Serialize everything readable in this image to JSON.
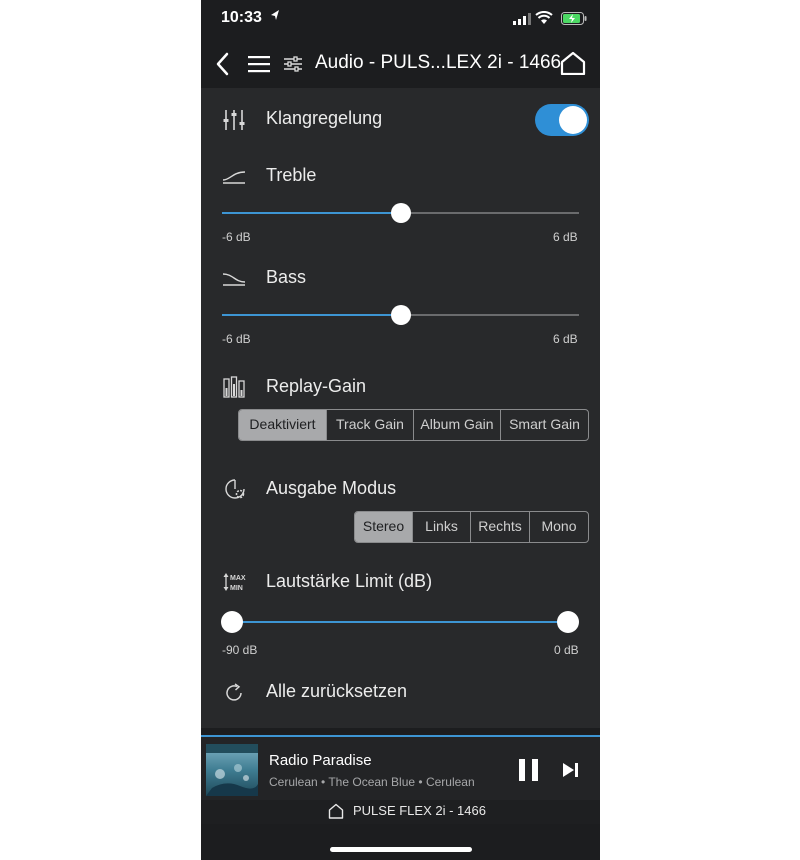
{
  "status": {
    "time": "10:33",
    "location_icon": "location-arrow-icon"
  },
  "nav": {
    "title": "Audio - PULS...LEX 2i - 1466"
  },
  "eq": {
    "label": "Klangregelung",
    "enabled": true
  },
  "treble": {
    "label": "Treble",
    "min_label": "-6 dB",
    "max_label": "6 dB",
    "value_fraction": 0.5
  },
  "bass": {
    "label": "Bass",
    "min_label": "-6 dB",
    "max_label": "6 dB",
    "value_fraction": 0.5
  },
  "replay_gain": {
    "label": "Replay-Gain",
    "options": [
      "Deaktiviert",
      "Track Gain",
      "Album Gain",
      "Smart Gain"
    ],
    "selected": "Deaktiviert"
  },
  "output_mode": {
    "label": "Ausgabe Modus",
    "options": [
      "Stereo",
      "Links",
      "Rechts",
      "Mono"
    ],
    "selected": "Stereo"
  },
  "volume_limit": {
    "label": "Lautstärke Limit (dB)",
    "min_label": "-90 dB",
    "max_label": "0 dB",
    "low_fraction": 0.0,
    "high_fraction": 1.0
  },
  "reset": {
    "label": "Alle zurücksetzen"
  },
  "player": {
    "station": "Radio Paradise",
    "track": "Cerulean • The Ocean Blue • Cerulean",
    "device": "PULSE FLEX 2i - 1466"
  },
  "colors": {
    "accent": "#3d95d3",
    "background": "#28292b",
    "toggle_on": "#2f8fd6"
  }
}
